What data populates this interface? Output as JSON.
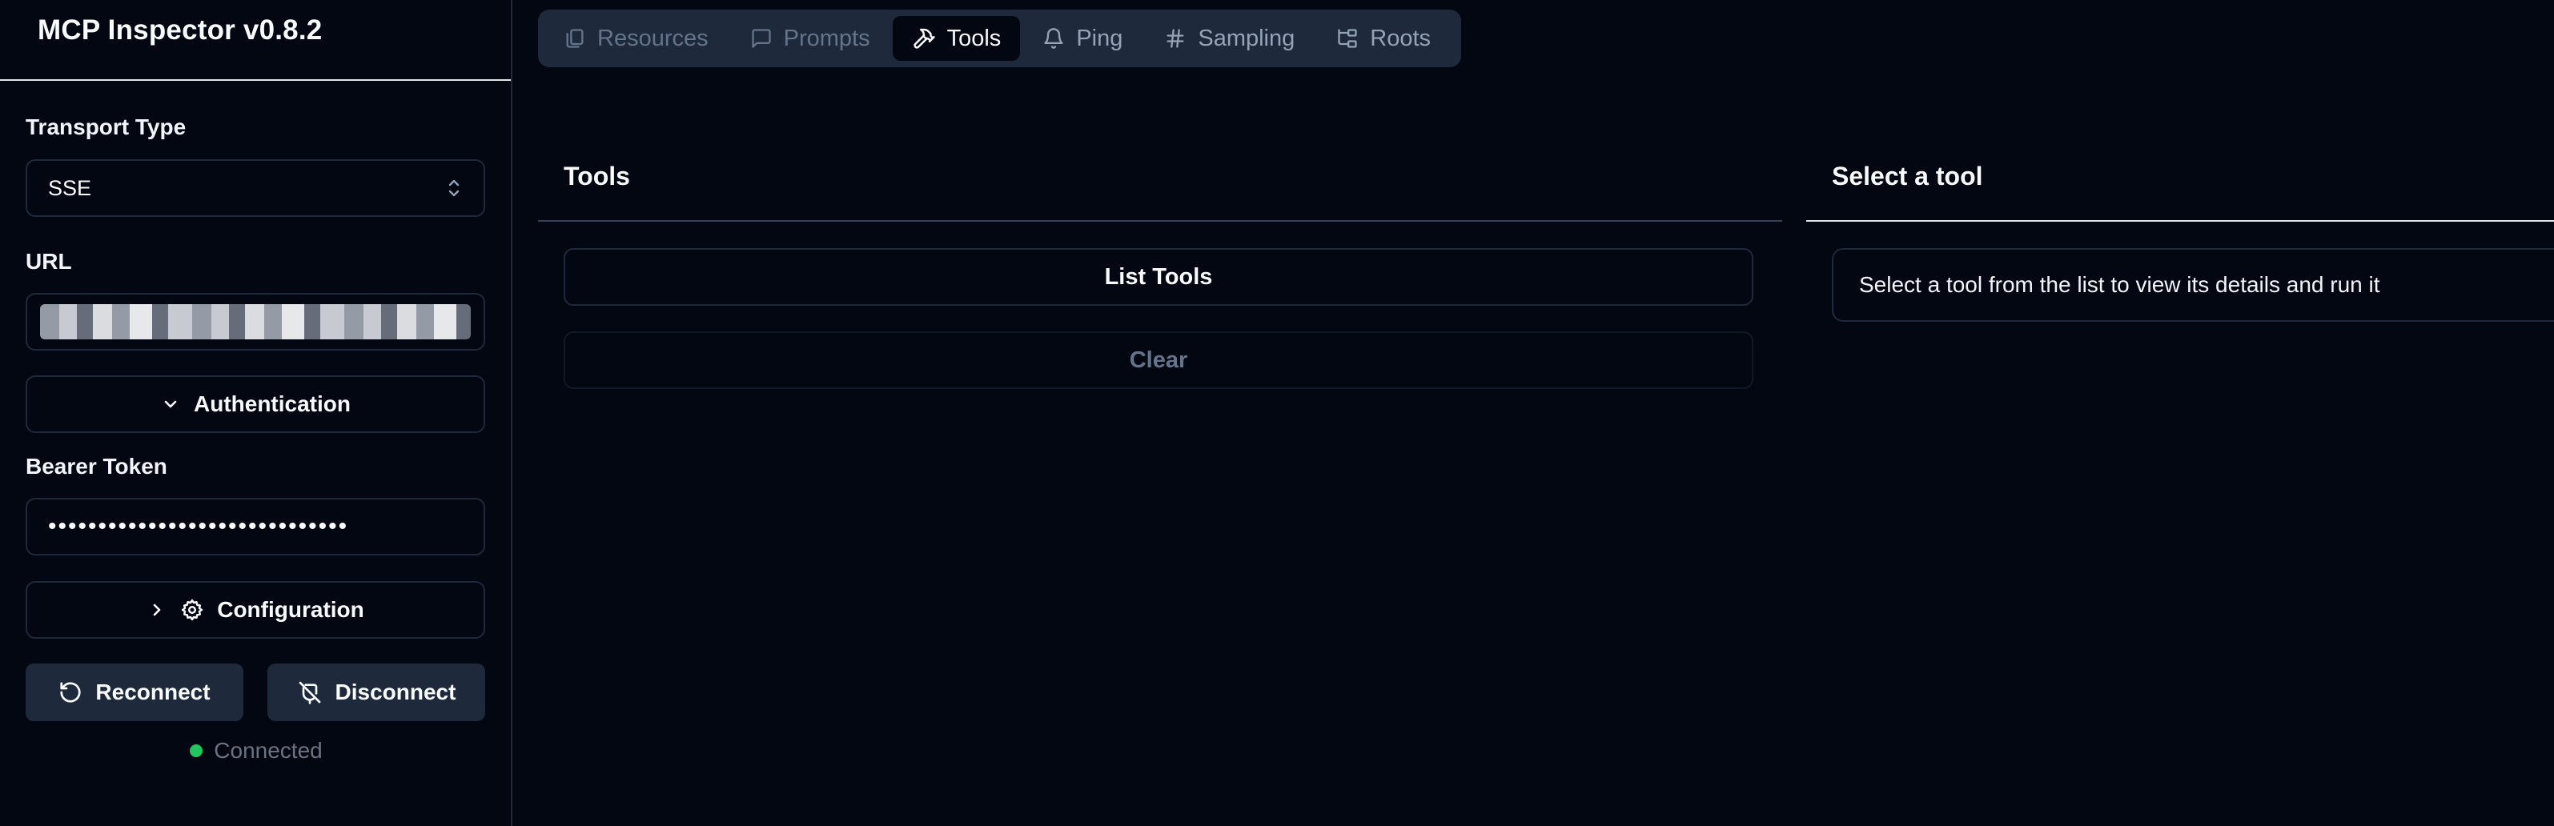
{
  "app": {
    "title": "MCP Inspector v0.8.2"
  },
  "sidebar": {
    "transport": {
      "label": "Transport Type",
      "value": "SSE"
    },
    "url": {
      "label": "URL"
    },
    "authentication": {
      "label": "Authentication"
    },
    "bearer": {
      "label": "Bearer Token",
      "masked_value": "••••••••••••••••••••••••••••••"
    },
    "configuration": {
      "label": "Configuration"
    },
    "reconnect": {
      "label": "Reconnect"
    },
    "disconnect": {
      "label": "Disconnect"
    },
    "status": {
      "text": "Connected",
      "color": "#22c55e"
    }
  },
  "tabs": [
    {
      "label": "Resources",
      "icon": "files-icon",
      "state": "disabled"
    },
    {
      "label": "Prompts",
      "icon": "message-square-icon",
      "state": "disabled"
    },
    {
      "label": "Tools",
      "icon": "hammer-icon",
      "state": "active"
    },
    {
      "label": "Ping",
      "icon": "bell-icon",
      "state": "normal"
    },
    {
      "label": "Sampling",
      "icon": "hash-icon",
      "state": "normal"
    },
    {
      "label": "Roots",
      "icon": "folder-tree-icon",
      "state": "normal"
    }
  ],
  "tools_panel": {
    "title": "Tools",
    "list_button": "List Tools",
    "clear_button": "Clear"
  },
  "details_panel": {
    "title": "Select a tool",
    "message": "Select a tool from the list to view its details and run it"
  },
  "colors": {
    "background": "#030712",
    "border": "#1e293b",
    "status_green": "#22c55e",
    "muted": "#64748b"
  }
}
